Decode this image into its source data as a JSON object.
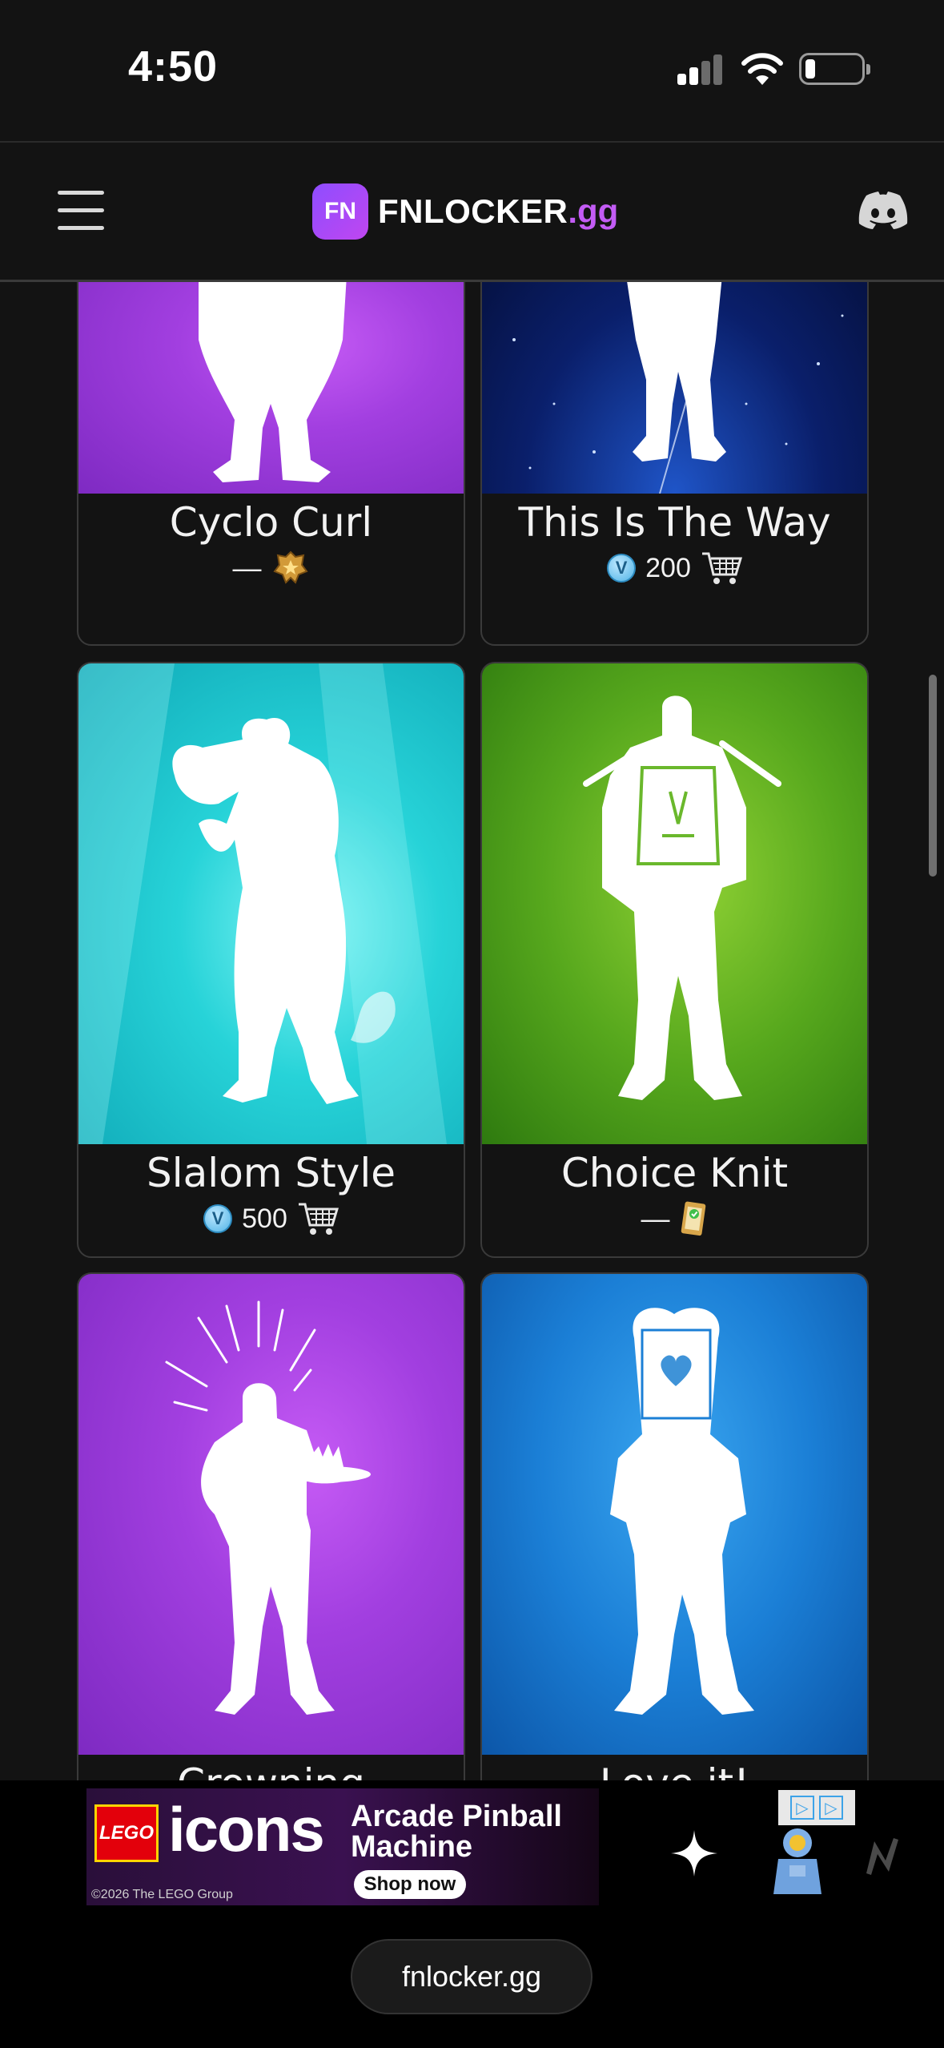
{
  "status": {
    "time": "4:50"
  },
  "header": {
    "brand_logo": "FN",
    "brand_name": "FNLOCKER",
    "brand_tld": ".gg",
    "icons": [
      "menu-icon",
      "discord-icon"
    ]
  },
  "emotes": [
    {
      "name": "Cyclo Curl",
      "price": "—",
      "source_icon": "battle-pass-icon",
      "background": "#a23fe0"
    },
    {
      "name": "This Is The Way",
      "price": "200",
      "currency_icon": "vbucks-icon",
      "source_icon": "cart-icon",
      "background": "#0a1f6b"
    },
    {
      "name": "Slalom Style",
      "price": "500",
      "currency_icon": "vbucks-icon",
      "source_icon": "cart-icon",
      "background": "#27d3d8"
    },
    {
      "name": "Choice Knit",
      "price": "—",
      "source_icon": "quest-card-icon",
      "background": "#57a81d"
    },
    {
      "name": "Crowning",
      "background": "#a23fe0"
    },
    {
      "name": "Love it!",
      "background": "#1b7fd6"
    }
  ],
  "ad": {
    "brand": "LEGO",
    "headline": "icons",
    "title": "Arcade Pinball Machine",
    "cta": "Shop now",
    "copyright": "©2026 The LEGO Group"
  },
  "browser": {
    "url": "fnlocker.gg"
  }
}
